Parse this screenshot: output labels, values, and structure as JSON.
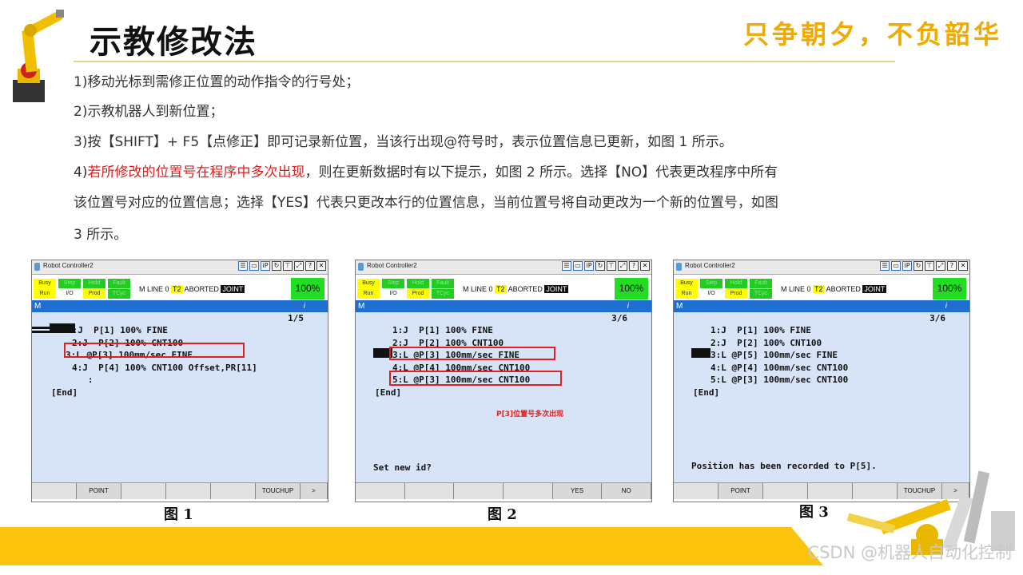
{
  "header": {
    "title": "示教修改法",
    "slogan": "只争朝夕，不负韶华"
  },
  "body": {
    "p1": "1)移动光标到需修正位置的动作指令的行号处；",
    "p2": "2)示教机器人到新位置；",
    "p3": "3)按【SHIFT】+ F5【点修正】即可记录新位置，当该行出现@符号时，表示位置信息已更新，如图 1 所示。",
    "p4_prefix": "4)",
    "p4_red": "若所修改的位置号在程序中多次出现",
    "p4_rest": "，则在更新数据时有以下提示，如图 2 所示。选择【NO】代表更改程序中所有",
    "p4_line2": "该位置号对应的位置信息；选择【YES】代表只更改本行的位置信息，当前位置号将自动更改为一个新的位置号，如图",
    "p4_line3": "3 所示。"
  },
  "controller": {
    "window_title": "Robot Controller2",
    "status_labels": [
      "Busy",
      "Step",
      "Hold",
      "Fault",
      "Run",
      "I/O",
      "Prod",
      "TCyc"
    ],
    "status_line_prefix": "M  LINE 0",
    "mode": "T2",
    "state": "ABORTED",
    "coord": "JOINT",
    "override": "100%",
    "menu_letter": "M",
    "info_icon": "i",
    "titlebar_buttons": [
      "menu-icon",
      "keyboard-icon",
      "ip-icon",
      "refresh-icon",
      "pin-icon",
      "resize-icon",
      "help-icon",
      "close-icon"
    ]
  },
  "figures": [
    {
      "caption": "图 1",
      "line_count": "1/5",
      "lines": [
        "1:J  P[1] 100% FINE",
        "2:J  P[2] 100% CNT100",
        "3:L @P[3] 100mm/sec FINE",
        "4:J  P[4] 100% CNT100 Offset,PR[11]",
        "   :",
        "[End]"
      ],
      "fkeys": [
        "",
        "POINT",
        "",
        "",
        "",
        "TOUCHUP",
        ">"
      ]
    },
    {
      "caption": "图 2",
      "line_count": "3/6",
      "lines": [
        "1:J  P[1] 100% FINE",
        "2:J  P[2] 100% CNT100",
        "3:L @P[3] 100mm/sec FINE",
        "4:L @P[4] 100mm/sec CNT100",
        "5:L @P[3] 100mm/sec CNT100",
        "[End]"
      ],
      "note": "P[3]位置号多次出现",
      "message": "Set new id?",
      "fkeys": [
        "",
        "",
        "",
        "",
        "YES",
        "NO"
      ]
    },
    {
      "caption": "图 3",
      "line_count": "3/6",
      "lines": [
        "1:J  P[1] 100% FINE",
        "2:J  P[2] 100% CNT100",
        "3:L @P[5] 100mm/sec FINE",
        "4:L @P[4] 100mm/sec CNT100",
        "5:L @P[3] 100mm/sec CNT100",
        "[End]"
      ],
      "message": "Position has been recorded to P[5].",
      "fkeys": [
        "",
        "POINT",
        "",
        "",
        "",
        "TOUCHUP",
        ">"
      ]
    }
  ],
  "footer": {
    "watermark": "CSDN @机器人自动化控制"
  },
  "colors": {
    "accent": "#f2a900",
    "footer_bar": "#fcc30d",
    "highlight": "#e02020",
    "screen_bg": "#d7e4f8",
    "menu_bar": "#1f6fd1"
  }
}
